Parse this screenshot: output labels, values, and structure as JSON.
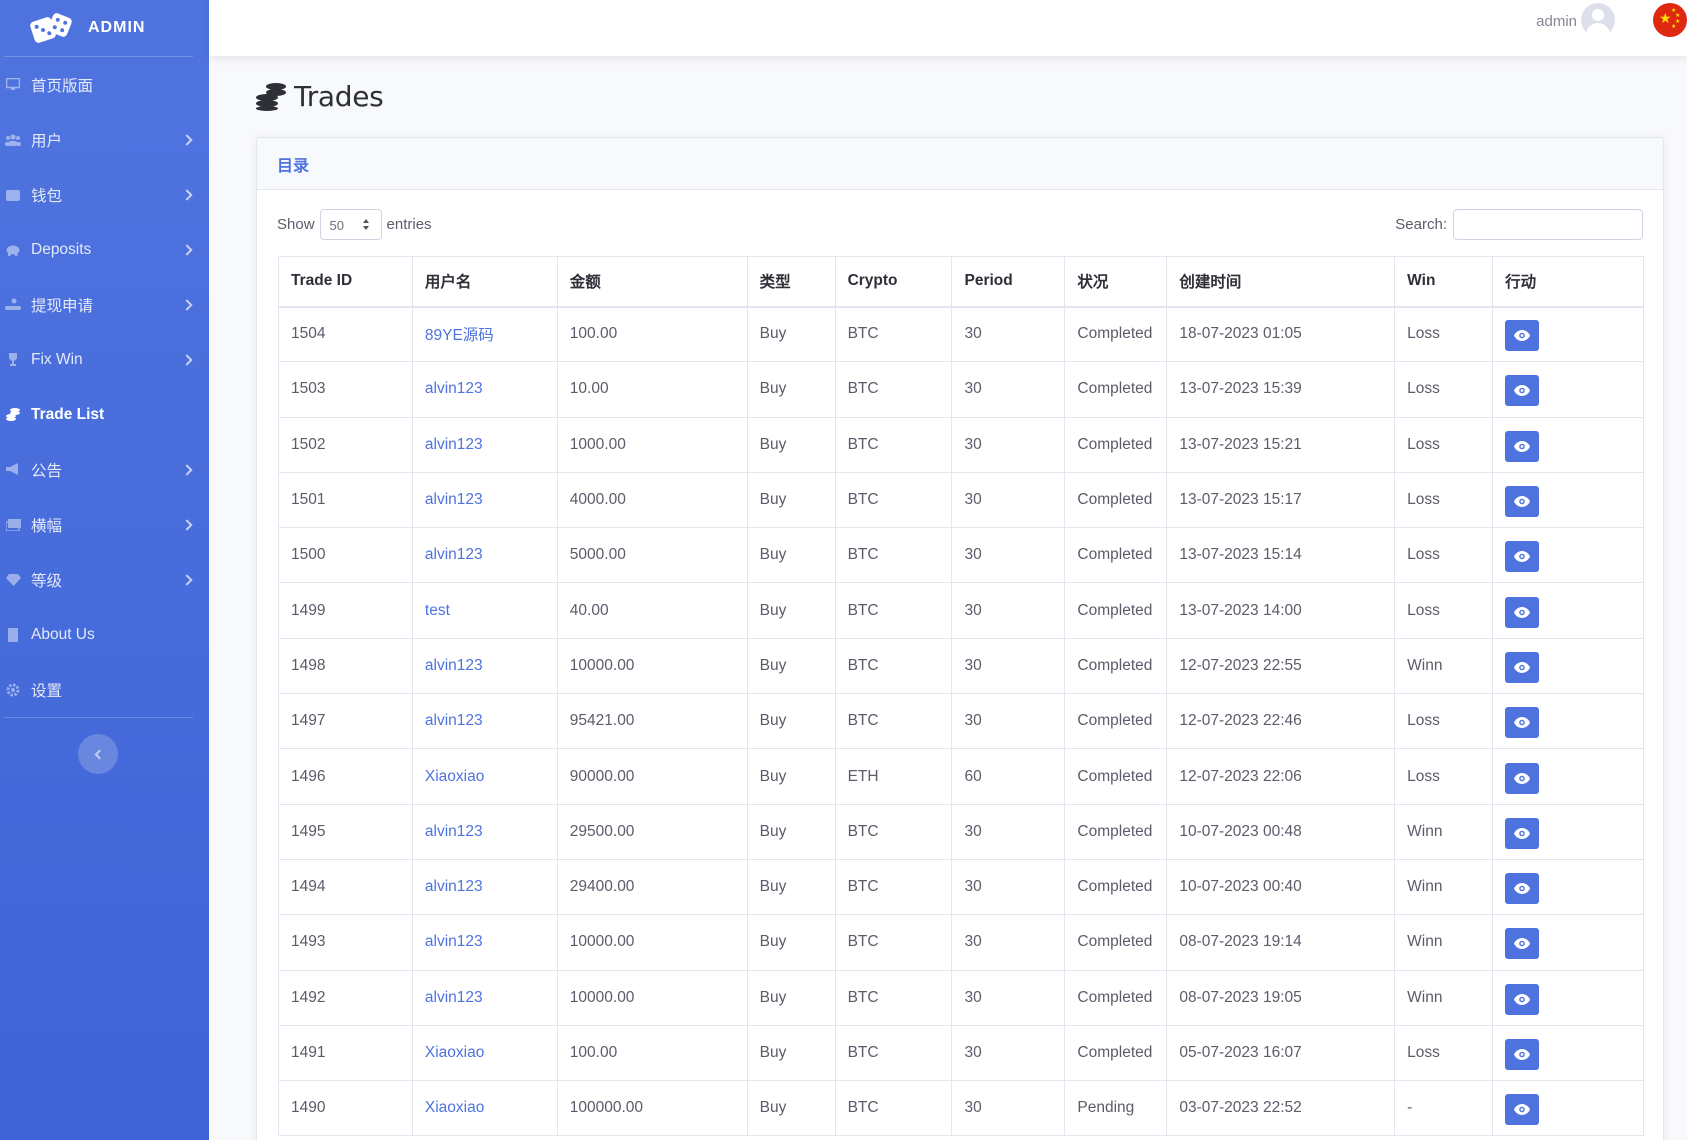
{
  "brand": {
    "text": "ADMIN"
  },
  "sidebar": {
    "items": [
      {
        "label": "首页版面",
        "icon": "desktop-icon",
        "has_submenu": false,
        "active": false
      },
      {
        "label": "用户",
        "icon": "users-icon",
        "has_submenu": true,
        "active": false
      },
      {
        "label": "钱包",
        "icon": "wallet-icon",
        "has_submenu": true,
        "active": false
      },
      {
        "label": "Deposits",
        "icon": "piggy-bank-icon",
        "has_submenu": true,
        "active": false
      },
      {
        "label": "提现申请",
        "icon": "withdraw-hand-icon",
        "has_submenu": true,
        "active": false
      },
      {
        "label": "Fix Win",
        "icon": "trophy-icon",
        "has_submenu": true,
        "active": false
      },
      {
        "label": "Trade List",
        "icon": "coins-icon",
        "has_submenu": false,
        "active": true
      },
      {
        "label": "公告",
        "icon": "bullhorn-icon",
        "has_submenu": true,
        "active": false
      },
      {
        "label": "横幅",
        "icon": "banner-icon",
        "has_submenu": true,
        "active": false
      },
      {
        "label": "等级",
        "icon": "gem-icon",
        "has_submenu": true,
        "active": false
      },
      {
        "label": "About Us",
        "icon": "building-icon",
        "has_submenu": false,
        "active": false
      },
      {
        "label": "设置",
        "icon": "gear-icon",
        "has_submenu": false,
        "active": false
      }
    ]
  },
  "topbar": {
    "user_name": "admin"
  },
  "page": {
    "title": "Trades"
  },
  "card": {
    "header": "目录",
    "show_label": "Show",
    "entries_value": "50",
    "entries_label": "entries",
    "search_label": "Search:",
    "search_value": ""
  },
  "table": {
    "columns": [
      "Trade ID",
      "用户名",
      "金额",
      "类型",
      "Crypto",
      "Period",
      "状况",
      "创建时间",
      "Win",
      "行动"
    ],
    "rows": [
      [
        "1504",
        "89YE源码",
        "100.00",
        "Buy",
        "BTC",
        "30",
        "Completed",
        "18-07-2023 01:05",
        "Loss"
      ],
      [
        "1503",
        "alvin123",
        "10.00",
        "Buy",
        "BTC",
        "30",
        "Completed",
        "13-07-2023 15:39",
        "Loss"
      ],
      [
        "1502",
        "alvin123",
        "1000.00",
        "Buy",
        "BTC",
        "30",
        "Completed",
        "13-07-2023 15:21",
        "Loss"
      ],
      [
        "1501",
        "alvin123",
        "4000.00",
        "Buy",
        "BTC",
        "30",
        "Completed",
        "13-07-2023 15:17",
        "Loss"
      ],
      [
        "1500",
        "alvin123",
        "5000.00",
        "Buy",
        "BTC",
        "30",
        "Completed",
        "13-07-2023 15:14",
        "Loss"
      ],
      [
        "1499",
        "test",
        "40.00",
        "Buy",
        "BTC",
        "30",
        "Completed",
        "13-07-2023 14:00",
        "Loss"
      ],
      [
        "1498",
        "alvin123",
        "10000.00",
        "Buy",
        "BTC",
        "30",
        "Completed",
        "12-07-2023 22:55",
        "Winn"
      ],
      [
        "1497",
        "alvin123",
        "95421.00",
        "Buy",
        "BTC",
        "30",
        "Completed",
        "12-07-2023 22:46",
        "Loss"
      ],
      [
        "1496",
        "Xiaoxiao",
        "90000.00",
        "Buy",
        "ETH",
        "60",
        "Completed",
        "12-07-2023 22:06",
        "Loss"
      ],
      [
        "1495",
        "alvin123",
        "29500.00",
        "Buy",
        "BTC",
        "30",
        "Completed",
        "10-07-2023 00:48",
        "Winn"
      ],
      [
        "1494",
        "alvin123",
        "29400.00",
        "Buy",
        "BTC",
        "30",
        "Completed",
        "10-07-2023 00:40",
        "Winn"
      ],
      [
        "1493",
        "alvin123",
        "10000.00",
        "Buy",
        "BTC",
        "30",
        "Completed",
        "08-07-2023 19:14",
        "Winn"
      ],
      [
        "1492",
        "alvin123",
        "10000.00",
        "Buy",
        "BTC",
        "30",
        "Completed",
        "08-07-2023 19:05",
        "Winn"
      ],
      [
        "1491",
        "Xiaoxiao",
        "100.00",
        "Buy",
        "BTC",
        "30",
        "Completed",
        "05-07-2023 16:07",
        "Loss"
      ],
      [
        "1490",
        "Xiaoxiao",
        "100000.00",
        "Buy",
        "BTC",
        "30",
        "Pending",
        "03-07-2023 22:52",
        "-"
      ]
    ],
    "action_icon": "eye-icon"
  },
  "colors": {
    "primary": "#4e73df",
    "sidebar_bottom": "#3f63d6",
    "text": "#5a5c69",
    "heading": "#2e2f37"
  }
}
